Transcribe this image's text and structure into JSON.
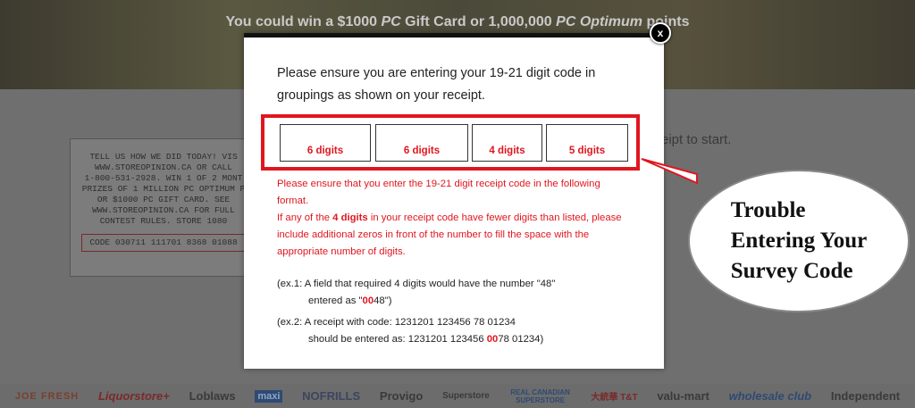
{
  "background": {
    "hero": {
      "prefix": "You could win a $1000 ",
      "pc": "PC",
      "middle": " Gift Card or 1,000,000 ",
      "pc_optimum": "PC Optimum",
      "suffix": " points"
    },
    "instruction_fragment": "eipt to start.",
    "receipt": {
      "lines": [
        "TELL US HOW WE DID TODAY! VIS",
        "WWW.STOREOPINION.CA OR CALL",
        "1-800-531-2928. WIN 1 OF 2 MONT",
        "PRIZES OF 1 MILLION PC OPTIMUM P",
        "OR $1000 PC GIFT CARD. SEE",
        "WWW.STOREOPINION.CA FOR FULL",
        "CONTEST RULES. STORE 1080"
      ],
      "code": "CODE 030711 111701 8368 01088"
    },
    "logos": [
      "JOE FRESH",
      "Liquorstore+",
      "Loblaws",
      "maxi",
      "NOFRILLS",
      "Provigo",
      "Superstore",
      "REAL CANADIAN SUPERSTORE",
      "大統華 T&T",
      "valu-mart",
      "wholesale club",
      "Independent"
    ]
  },
  "modal": {
    "close_label": "x",
    "intro": "Please ensure you are entering your 19-21 digit code in groupings as shown on your receipt.",
    "fields": [
      {
        "label": "6 digits"
      },
      {
        "label": "6 digits"
      },
      {
        "label": "4 digits"
      },
      {
        "label": "5 digits"
      }
    ],
    "warning": {
      "line1": "Please ensure that you enter the 19-21 digit receipt code in the following format.",
      "line2_prefix": "If any of the ",
      "line2_bold": "4 digits",
      "line2_suffix": " in your receipt code have fewer digits than listed, please include additional zeros in front of the number to fill the space with the appropriate number of digits."
    },
    "example1": {
      "line1": "(ex.1: A field that required 4 digits would have the number \"48\"",
      "line2_prefix": "entered as \"",
      "line2_red": "00",
      "line2_suffix": "48\")"
    },
    "example2": {
      "line1": "(ex.2: A receipt with code: 1231201 123456 78 01234",
      "line2_prefix": "should be entered as: 1231201 123456 ",
      "line2_red": "00",
      "line2_suffix": "78 01234)"
    }
  },
  "annotation": {
    "lines": [
      "Trouble",
      "Entering Your",
      "Survey Code"
    ]
  },
  "colors": {
    "accent_red": "#e0161f",
    "overlay_dark": "#6b6b6b"
  }
}
